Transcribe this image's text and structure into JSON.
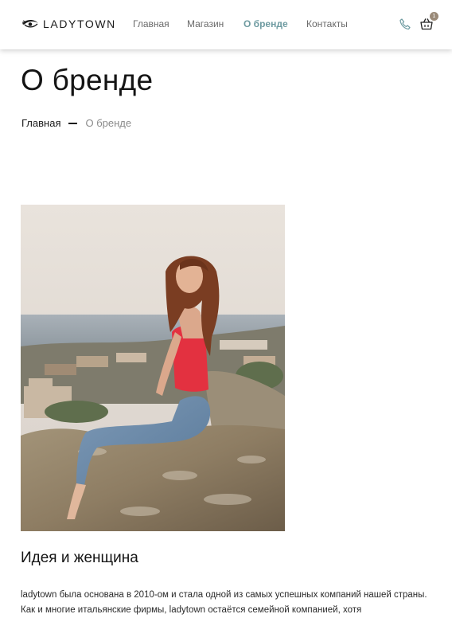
{
  "header": {
    "logo_text": "LADYTOWN",
    "nav": [
      {
        "label": "Главная",
        "active": false
      },
      {
        "label": "Магазин",
        "active": false
      },
      {
        "label": "О бренде",
        "active": true
      },
      {
        "label": "Контакты",
        "active": false
      }
    ],
    "phone_icon": "phone-icon",
    "cart_icon": "shopping-basket-icon",
    "cart_count": "1"
  },
  "page": {
    "title": "О бренде",
    "breadcrumb": {
      "home": "Главная",
      "current": "О бренде"
    }
  },
  "content": {
    "photo": "woman-sitting-on-rock-photo",
    "heading": "Идея и женщина",
    "paragraph": "ladytown была основана в 2010-ом и стала одной из самых успешных компаний нашей страны. Как и многие итальянские фирмы, ladytown остаётся семейной компанией, хотя"
  },
  "colors": {
    "accent": "#6d9aa0",
    "nav_text": "#6a6a6a",
    "badge": "#9a8a78"
  }
}
